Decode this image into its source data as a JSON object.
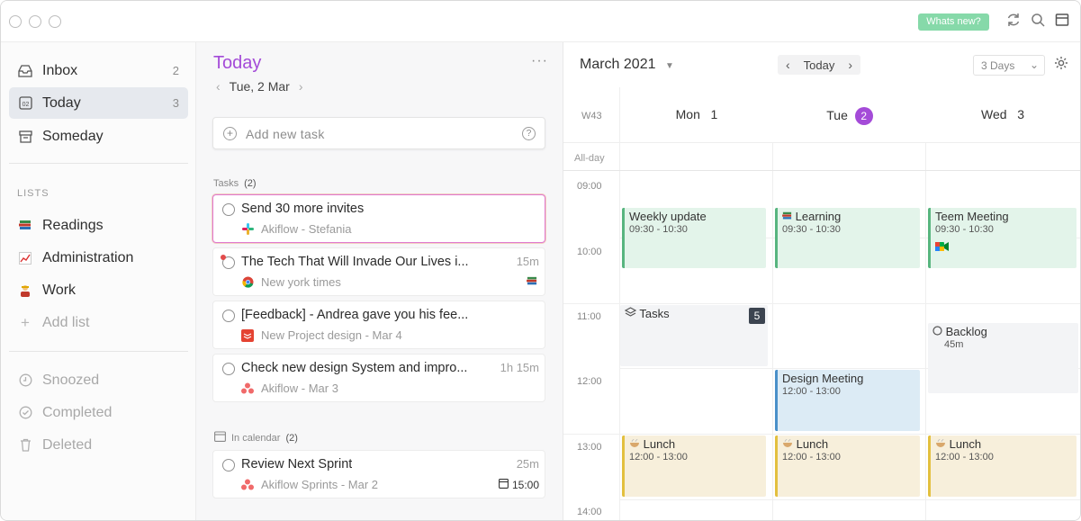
{
  "titlebar": {
    "whats_new": "Whats new?",
    "icons": [
      "sync-icon",
      "search-icon",
      "calendar-view-icon"
    ]
  },
  "sidebar": {
    "items": [
      {
        "label": "Inbox",
        "count": "2",
        "icon": "inbox-icon"
      },
      {
        "label": "Today",
        "count": "3",
        "icon": "today-icon"
      },
      {
        "label": "Someday",
        "count": "",
        "icon": "archive-box-icon"
      }
    ],
    "lists_title": "LISTS",
    "lists": [
      {
        "label": "Readings",
        "icon": "books-icon"
      },
      {
        "label": "Administration",
        "icon": "chart-icon"
      },
      {
        "label": "Work",
        "icon": "worker-icon"
      }
    ],
    "add_list": "Add list",
    "bottom": [
      {
        "label": "Snoozed",
        "icon": "clock-icon"
      },
      {
        "label": "Completed",
        "icon": "check-circle-icon"
      },
      {
        "label": "Deleted",
        "icon": "trash-icon"
      }
    ]
  },
  "tasks_panel": {
    "title": "Today",
    "date": "Tue, 2 Mar",
    "add_task_placeholder": "Add new task",
    "help": "?",
    "tasks_section_label": "Tasks",
    "tasks_section_count": "(2)",
    "tasks": [
      {
        "title": "Send 30 more invites",
        "duration": "",
        "source": "Akiflow - Stefania",
        "source_icon": "slack-icon"
      },
      {
        "title": "The Tech That Will Invade Our Lives i...",
        "duration": "15m",
        "source": "New york times",
        "source_icon": "chrome-icon"
      },
      {
        "title": "[Feedback] - Andrea gave you his fee...",
        "duration": "",
        "source": "New Project design - Mar 4",
        "source_icon": "todoist-icon"
      },
      {
        "title": "Check new design System and impro...",
        "duration": "1h 15m",
        "source": "Akiflow - Mar 3",
        "source_icon": "asana-icon"
      }
    ],
    "calendar_section_label": "In calendar",
    "calendar_section_count": "(2)",
    "calendar_tasks": [
      {
        "title": "Review Next Sprint",
        "duration": "25m",
        "source": "Akiflow Sprints - Mar 2",
        "source_icon": "asana-icon",
        "time": "15:00"
      }
    ]
  },
  "calendar": {
    "month": "March 2021",
    "today_label": "Today",
    "view_select": "3 Days",
    "week": "W43",
    "all_day": "All-day",
    "days": [
      {
        "name": "Mon",
        "num": "1"
      },
      {
        "name": "Tue",
        "num": "2"
      },
      {
        "name": "Wed",
        "num": "3"
      }
    ],
    "hours": [
      "09:00",
      "10:00",
      "11:00",
      "12:00",
      "13:00",
      "14:00"
    ],
    "events": {
      "mon_weekly": {
        "title": "Weekly update",
        "time": "09:30 - 10:30"
      },
      "tue_learning": {
        "title": "Learning",
        "time": "09:30 - 10:30"
      },
      "wed_teem": {
        "title": "Teem Meeting",
        "time": "09:30 - 10:30"
      },
      "mon_tasks": {
        "title": "Tasks",
        "count": "5"
      },
      "wed_backlog": {
        "title": "Backlog",
        "duration": "45m"
      },
      "tue_design": {
        "title": "Design Meeting",
        "time": "12:00 - 13:00"
      },
      "mon_lunch": {
        "title": "Lunch",
        "time": "12:00 - 13:00"
      },
      "tue_lunch": {
        "title": "Lunch",
        "time": "12:00 - 13:00"
      },
      "wed_lunch": {
        "title": "Lunch",
        "time": "12:00 - 13:00"
      }
    }
  },
  "colors": {
    "accent": "#a44bd8",
    "whats_new_bg": "#86d9a9",
    "event_green": "#e3f4ea",
    "event_blue": "#dcebf5",
    "event_yellow": "#f7efdb"
  }
}
